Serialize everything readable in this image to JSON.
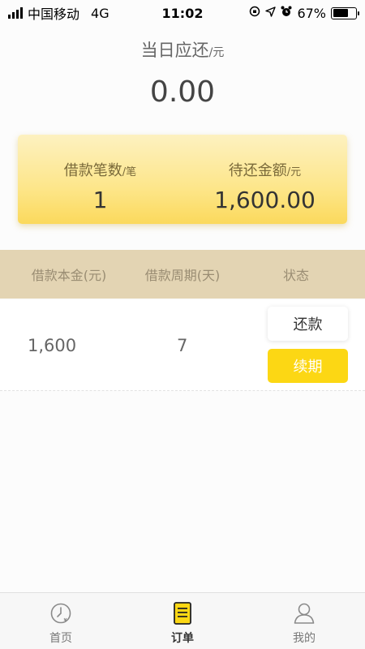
{
  "status_bar": {
    "carrier": "中国移动",
    "network": "4G",
    "time": "11:02",
    "battery_percent_text": "67%",
    "battery_level": 0.67
  },
  "due_today": {
    "title": "当日应还",
    "unit": "/元",
    "amount": "0.00"
  },
  "summary": {
    "count_label": "借款笔数",
    "count_unit": "/笔",
    "count_value": "1",
    "pending_label": "待还金额",
    "pending_unit": "/元",
    "pending_value": "1,600.00"
  },
  "table": {
    "headers": [
      "借款本金(元)",
      "借款周期(天)",
      "状态"
    ],
    "rows": [
      {
        "principal": "1,600",
        "period": "7",
        "repay_label": "还款",
        "renew_label": "续期"
      }
    ]
  },
  "tab_bar": {
    "items": [
      {
        "label": "首页",
        "icon": "home-clock-icon"
      },
      {
        "label": "订单",
        "icon": "order-document-icon",
        "active": true
      },
      {
        "label": "我的",
        "icon": "user-profile-icon"
      }
    ]
  },
  "colors": {
    "accent_yellow": "#fcd714",
    "header_tan": "#e3d4b3",
    "card_yellow": "#fde68a"
  }
}
